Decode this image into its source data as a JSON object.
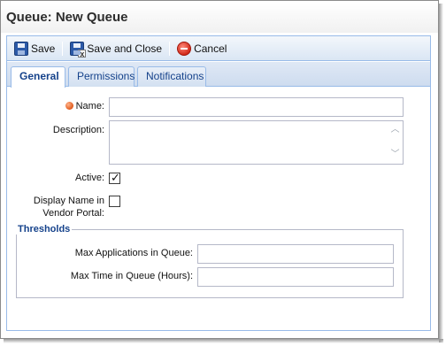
{
  "window": {
    "title": "Queue: New Queue"
  },
  "toolbar": {
    "save_label": "Save",
    "save_close_label": "Save and Close",
    "cancel_label": "Cancel"
  },
  "tabs": [
    {
      "label": "General",
      "active": true
    },
    {
      "label": "Permissions",
      "active": false
    },
    {
      "label": "Notifications",
      "active": false
    }
  ],
  "form": {
    "name_label": "Name:",
    "name_value": "",
    "description_label": "Description:",
    "description_value": "",
    "active_label": "Active:",
    "active_checked": true,
    "display_name_label_line1": "Display Name in",
    "display_name_label_line2": "Vendor Portal:",
    "display_name_checked": false
  },
  "thresholds": {
    "legend": "Thresholds",
    "max_apps_label": "Max Applications in Queue:",
    "max_apps_value": "",
    "max_time_label": "Max Time in Queue (Hours):",
    "max_time_value": ""
  },
  "icons": {
    "save": "floppy-disk-icon",
    "save_close": "floppy-disk-close-icon",
    "cancel": "cancel-icon",
    "required": "required-dot-icon",
    "check": "✓"
  },
  "colors": {
    "accent": "#15428b",
    "panel_border": "#99bbe8",
    "required": "#e05a1c"
  }
}
